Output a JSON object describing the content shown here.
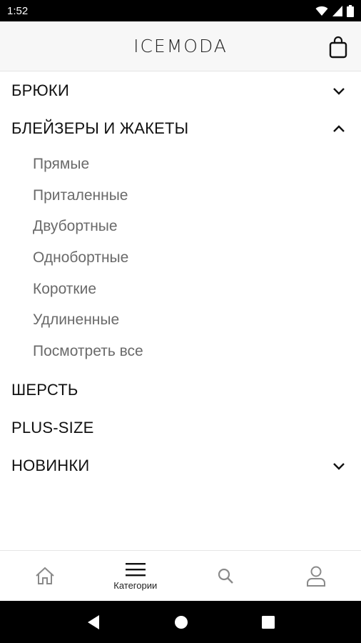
{
  "status_bar": {
    "time": "1:52",
    "icons": [
      "wifi-icon",
      "signal-icon",
      "battery-icon"
    ]
  },
  "header": {
    "brand": "ICEMODA",
    "cart_icon": "shopping-bag-icon"
  },
  "menu": {
    "categories": [
      {
        "label": "БРЮКИ",
        "state": "collapsed"
      },
      {
        "label": "БЛЕЙЗЕРЫ И ЖАКЕТЫ",
        "state": "expanded",
        "subitems": [
          "Прямые",
          "Приталенные",
          "Двубортные",
          "Однобортные",
          "Короткие",
          "Удлиненные",
          "Посмотреть все"
        ]
      },
      {
        "label": "ШЕРСТЬ"
      },
      {
        "label": "PLUS-SIZE"
      },
      {
        "label": "НОВИНКИ",
        "state": "collapsed"
      }
    ]
  },
  "bottom_nav": {
    "items": [
      {
        "icon": "home-icon",
        "label": ""
      },
      {
        "icon": "menu-icon",
        "label": "Категории",
        "active": true
      },
      {
        "icon": "search-icon",
        "label": ""
      },
      {
        "icon": "profile-icon",
        "label": ""
      }
    ]
  },
  "system_nav": [
    "back-icon",
    "home-circle-icon",
    "recents-icon"
  ],
  "colors": {
    "status_bar": "#000000",
    "header_bg": "#f7f7f7",
    "subitem_text": "#6a6a6a",
    "category_text": "#111111"
  }
}
